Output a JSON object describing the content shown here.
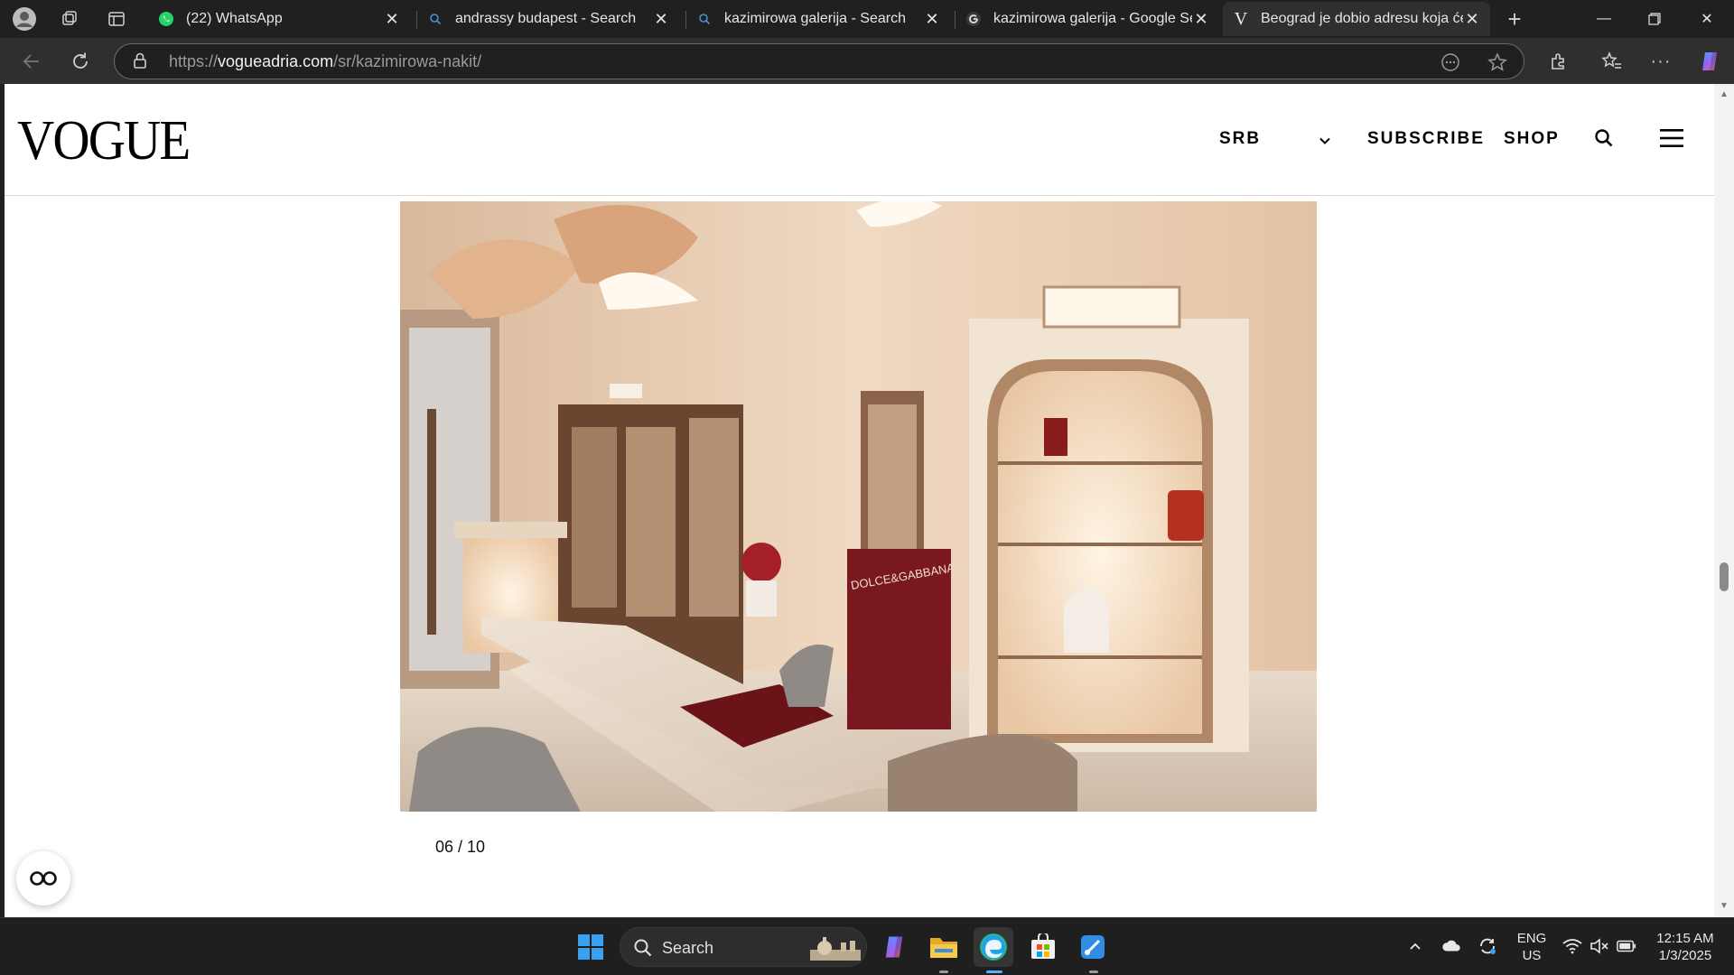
{
  "browser": {
    "tabs": [
      {
        "title": "(22) WhatsApp",
        "icon": "whatsapp-icon"
      },
      {
        "title": "andrassy budapest - Search",
        "icon": "search-icon"
      },
      {
        "title": "kazimirowa galerija - Search",
        "icon": "search-icon"
      },
      {
        "title": "kazimirowa galerija - Google Sear",
        "icon": "google-icon"
      },
      {
        "title": "Beograd je dobio adresu koja će p",
        "icon": "vogue-icon",
        "active": true
      }
    ],
    "url_prefix": "https://",
    "url_host": "vogueadria.com",
    "url_path": "/sr/kazimirowa-nakit/"
  },
  "site": {
    "logo": "VOGUE",
    "nav": {
      "language": "SRB",
      "subscribe": "SUBSCRIBE",
      "shop": "SHOP"
    },
    "gallery": {
      "counter": "06 / 10",
      "brand_panel_text": "DOLCE&GABBANA"
    }
  },
  "taskbar": {
    "search_label": "Search",
    "lang_primary": "ENG",
    "lang_secondary": "US",
    "time": "12:15 AM",
    "date": "1/3/2025"
  },
  "colors": {
    "accent": "#2f2f2f",
    "edge_blue": "#1fa2e8",
    "whatsapp_green": "#25d366"
  }
}
